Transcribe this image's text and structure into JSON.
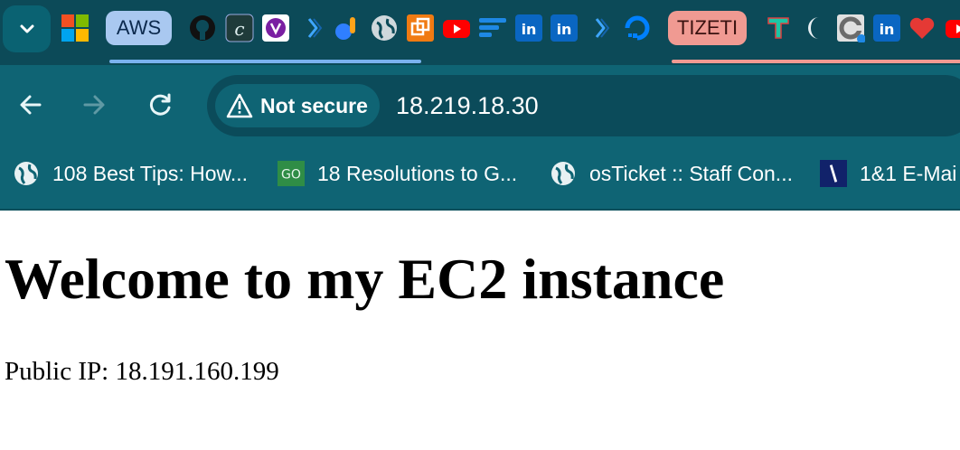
{
  "tabs": {
    "pinned_aws_label": "AWS",
    "pinned_tizeti_label": "TIZETI",
    "favicons": [
      "microsoft-icon",
      "github-icon",
      "c-app-icon",
      "purple-app-icon",
      "ms-copilot-icon",
      "blue-app-icon",
      "globe-icon",
      "orange-app-icon",
      "youtube-icon",
      "blue-lines-icon",
      "linkedin-icon",
      "linkedin-icon",
      "ms-copilot-icon",
      "digitalocean-icon",
      "t-app-icon",
      "moon-app-icon",
      "c-grey-app-icon",
      "linkedin-icon",
      "heart-icon",
      "youtube-icon"
    ]
  },
  "toolbar": {
    "security_label": "Not secure",
    "url": "18.219.18.30"
  },
  "bookmarks": [
    {
      "label": "108 Best Tips: How...",
      "icon": "globe-icon"
    },
    {
      "label": "18 Resolutions to G...",
      "icon": "go-icon"
    },
    {
      "label": "osTicket :: Staff Con...",
      "icon": "globe-icon"
    },
    {
      "label": "1&1 E-Mai",
      "icon": "ionos-icon"
    }
  ],
  "page": {
    "heading": "Welcome to my EC2 instance",
    "text": "Public IP: 18.191.160.199"
  },
  "colors": {
    "tab_strip": "#0c4a58",
    "toolbar": "#0f6474",
    "omnibox": "#0b4b5a",
    "aws_group": "#a9c8f0",
    "tizeti_group": "#f09a92"
  }
}
